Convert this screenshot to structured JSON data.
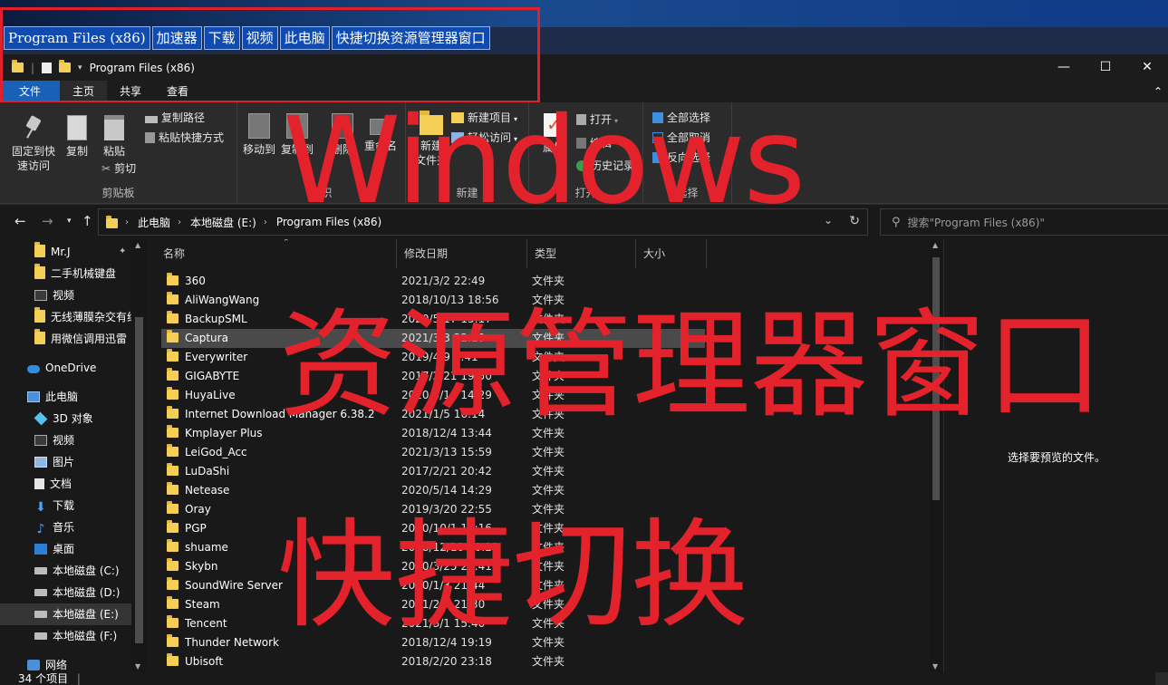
{
  "quickbar": [
    "Program Files (x86)",
    "加速器",
    "下载",
    "视频",
    "此电脑",
    "快捷切换资源管理器窗口"
  ],
  "window": {
    "title": "Program Files (x86)"
  },
  "tabs": {
    "file": "文件",
    "home": "主页",
    "share": "共享",
    "view": "查看"
  },
  "ribbon": {
    "clipboard": {
      "pin": "固定到快速访问",
      "pin_l1": "固定到快",
      "pin_l2": "速访问",
      "copy": "复制",
      "paste": "粘贴",
      "copy_path": "复制路径",
      "paste_shortcut": "粘贴快捷方式",
      "cut": "剪切",
      "label": "剪贴板"
    },
    "organize": {
      "move": "移动到",
      "copy_to": "复制到",
      "delete": "删除",
      "rename": "重命名",
      "label": "组织"
    },
    "new": {
      "new_folder": "新建文件夹",
      "new_folder_l1": "新建",
      "new_folder_l2": "文件夹",
      "new_item": "新建项目",
      "easy_access": "轻松访问",
      "label": "新建"
    },
    "open": {
      "properties": "属性",
      "open": "打开",
      "edit": "编辑",
      "history": "历史记录",
      "label": "打开"
    },
    "select": {
      "all": "全部选择",
      "none": "全部取消",
      "invert": "反向选择",
      "label": "选择"
    }
  },
  "address": {
    "crumbs": [
      "此电脑",
      "本地磁盘 (E:)",
      "Program Files (x86)"
    ],
    "search_placeholder": "搜索\"Program Files (x86)\""
  },
  "nav": {
    "pinned": [
      "Mr.J",
      "二手机械键盘",
      "视频",
      "无线薄膜杂交有线",
      "用微信调用迅雷"
    ],
    "onedrive": "OneDrive",
    "thispc": "此电脑",
    "pc_items": [
      "3D 对象",
      "视频",
      "图片",
      "文档",
      "下载",
      "音乐",
      "桌面"
    ],
    "drives": [
      "本地磁盘 (C:)",
      "本地磁盘 (D:)",
      "本地磁盘 (E:)",
      "本地磁盘 (F:)"
    ],
    "network": "网络"
  },
  "columns": {
    "name": "名称",
    "date": "修改日期",
    "type": "类型",
    "size": "大小"
  },
  "files": [
    {
      "name": "360",
      "date": "2021/3/2 22:49",
      "type": "文件夹"
    },
    {
      "name": "AliWangWang",
      "date": "2018/10/13 18:56",
      "type": "文件夹"
    },
    {
      "name": "BackupSML",
      "date": "2020/5/17 15:17",
      "type": "文件夹"
    },
    {
      "name": "Captura",
      "date": "2021/3/3 22:10",
      "type": "文件夹"
    },
    {
      "name": "Everywriter",
      "date": "2019/4/9 9:41",
      "type": "文件夹"
    },
    {
      "name": "GIGABYTE",
      "date": "2017/2/21 19:50",
      "type": "文件夹"
    },
    {
      "name": "HuyaLive",
      "date": "2020/5/14 14:29",
      "type": "文件夹"
    },
    {
      "name": "Internet Download Manager 6.38.2",
      "date": "2021/1/5 16:14",
      "type": "文件夹"
    },
    {
      "name": "Kmplayer Plus",
      "date": "2018/12/4 13:44",
      "type": "文件夹"
    },
    {
      "name": "LeiGod_Acc",
      "date": "2021/3/13 15:59",
      "type": "文件夹"
    },
    {
      "name": "LuDaShi",
      "date": "2017/2/21 20:42",
      "type": "文件夹"
    },
    {
      "name": "Netease",
      "date": "2020/5/14 14:29",
      "type": "文件夹"
    },
    {
      "name": "Oray",
      "date": "2019/3/20 22:55",
      "type": "文件夹"
    },
    {
      "name": "PGP",
      "date": "2020/10/1 11:16",
      "type": "文件夹"
    },
    {
      "name": "shuame",
      "date": "2018/12/10 10:22",
      "type": "文件夹"
    },
    {
      "name": "Skybn",
      "date": "2020/3/25 21:41",
      "type": "文件夹"
    },
    {
      "name": "SoundWire Server",
      "date": "2020/1/3 21:44",
      "type": "文件夹"
    },
    {
      "name": "Steam",
      "date": "2021/2/4 21:30",
      "type": "文件夹"
    },
    {
      "name": "Tencent",
      "date": "2021/3/1 15:40",
      "type": "文件夹"
    },
    {
      "name": "Thunder Network",
      "date": "2018/12/4 19:19",
      "type": "文件夹"
    },
    {
      "name": "Ubisoft",
      "date": "2018/2/20 23:18",
      "type": "文件夹"
    }
  ],
  "preview": "选择要预览的文件。",
  "status": "34 个项目",
  "overlay": {
    "line1": "Windows",
    "line2": "资源管理器窗口",
    "line3": "快捷切换"
  },
  "colors": {
    "accent": "#1960b8",
    "overlay_red": "#e4222b",
    "folder": "#f4cf55"
  }
}
